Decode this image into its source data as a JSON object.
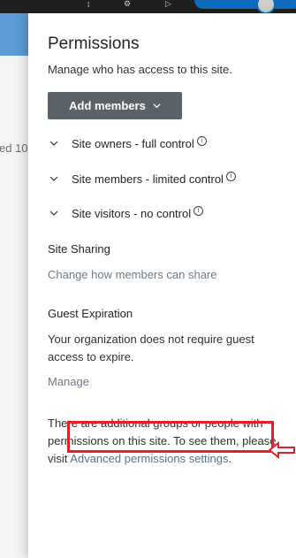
{
  "panel": {
    "title": "Permissions",
    "description": "Manage who has access to this site.",
    "add_members_label": "Add members",
    "groups": [
      {
        "label": "Site owners - full control"
      },
      {
        "label": "Site members - limited control"
      },
      {
        "label": "Site visitors - no control"
      }
    ],
    "site_sharing": {
      "heading": "Site Sharing",
      "link": "Change how members can share"
    },
    "guest_expiration": {
      "heading": "Guest Expiration",
      "text": "Your organization does not require guest access to expire.",
      "link": "Manage"
    },
    "additional": {
      "text": "There are additional groups or people with permissions on this site. To see them, please visit ",
      "link": "Advanced permissions settings",
      "suffix": "."
    }
  },
  "background": {
    "fragment": "ed 10"
  },
  "info_glyph": "i",
  "colors": {
    "annotation": "#e0202a",
    "button": "#5a6268",
    "accent": "#0f6cbd"
  }
}
